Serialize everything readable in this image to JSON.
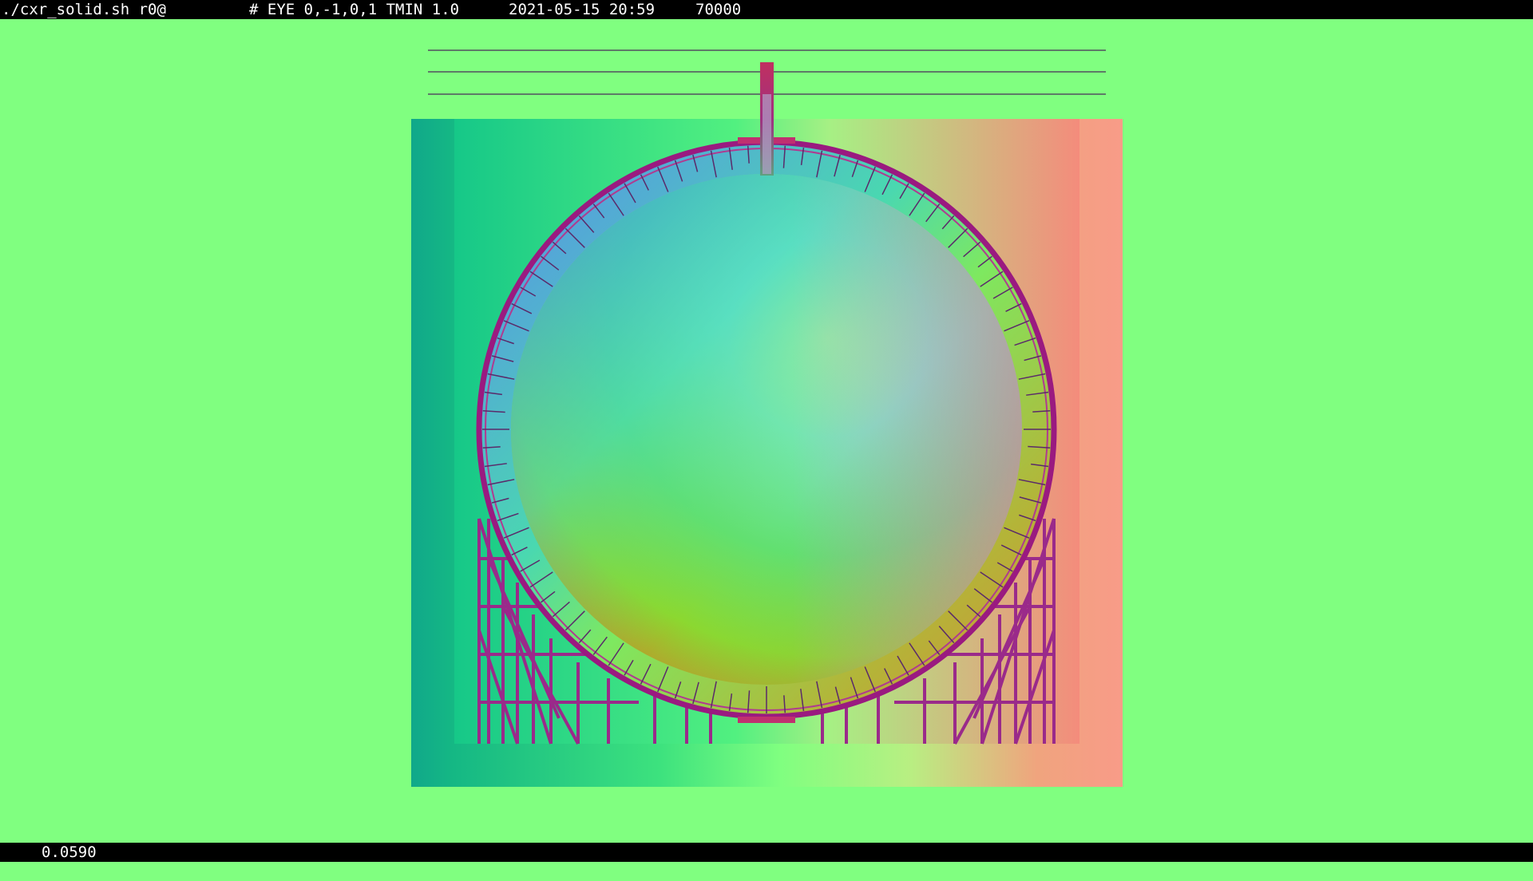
{
  "window": {
    "command": "./cxr_solid.sh r0@",
    "eye_info": "# EYE 0,-1,0,1 TMIN 1.0",
    "datetime": "2021-05-15 20:59",
    "count": "70000"
  },
  "status": {
    "timing": "0.0590"
  },
  "render": {
    "description_icon": "ray-trace-render",
    "background_color": "#80ff80",
    "bar_color": "#000000"
  }
}
